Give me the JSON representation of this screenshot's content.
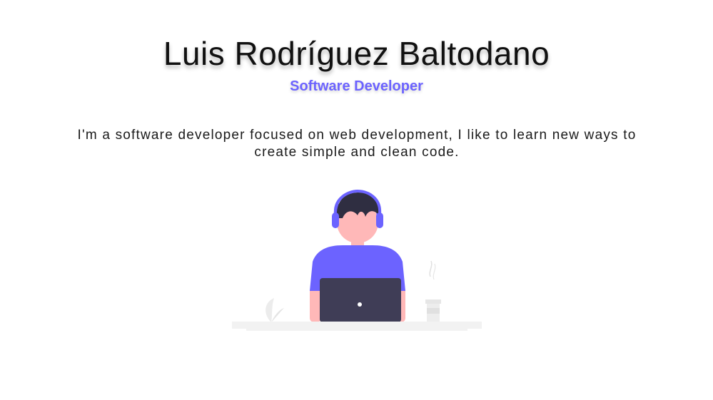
{
  "profile": {
    "name": "Luis Rodríguez Baltodano",
    "role": "Software Developer",
    "bio": "I'm a software developer focused on web development, I like to learn new ways to create simple and clean code."
  },
  "illustration": {
    "icon": "developer-at-laptop-illustration",
    "colors": {
      "accent": "#6c63ff",
      "skin": "#ffb8b8",
      "hair": "#2f2e41",
      "laptop": "#3f3d56",
      "desk": "#f2f2f2"
    }
  }
}
